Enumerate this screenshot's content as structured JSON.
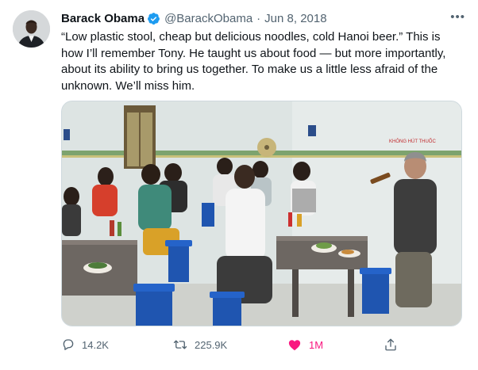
{
  "tweet": {
    "author_name": "Barack Obama",
    "verified": true,
    "handle": "@BarackObama",
    "separator": "·",
    "date": "Jun 8, 2018",
    "more_icon": "more-icon",
    "text": "“Low plastic stool, cheap but delicious noodles, cold Hanoi beer.” This is how I’ll remember Tony. He taught us about food — but more importantly, about its ability to bring us together. To make us a little less afraid of the unknown. We’ll miss him.",
    "media": {
      "sign_text": "KHÔNG HÚT THUỐC"
    },
    "stats": {
      "replies": "14.2K",
      "retweets": "225.9K",
      "likes": "1M"
    }
  },
  "colors": {
    "verified_blue": "#1d9bf0",
    "secondary_text": "#536471",
    "like_pink": "#f91880"
  }
}
